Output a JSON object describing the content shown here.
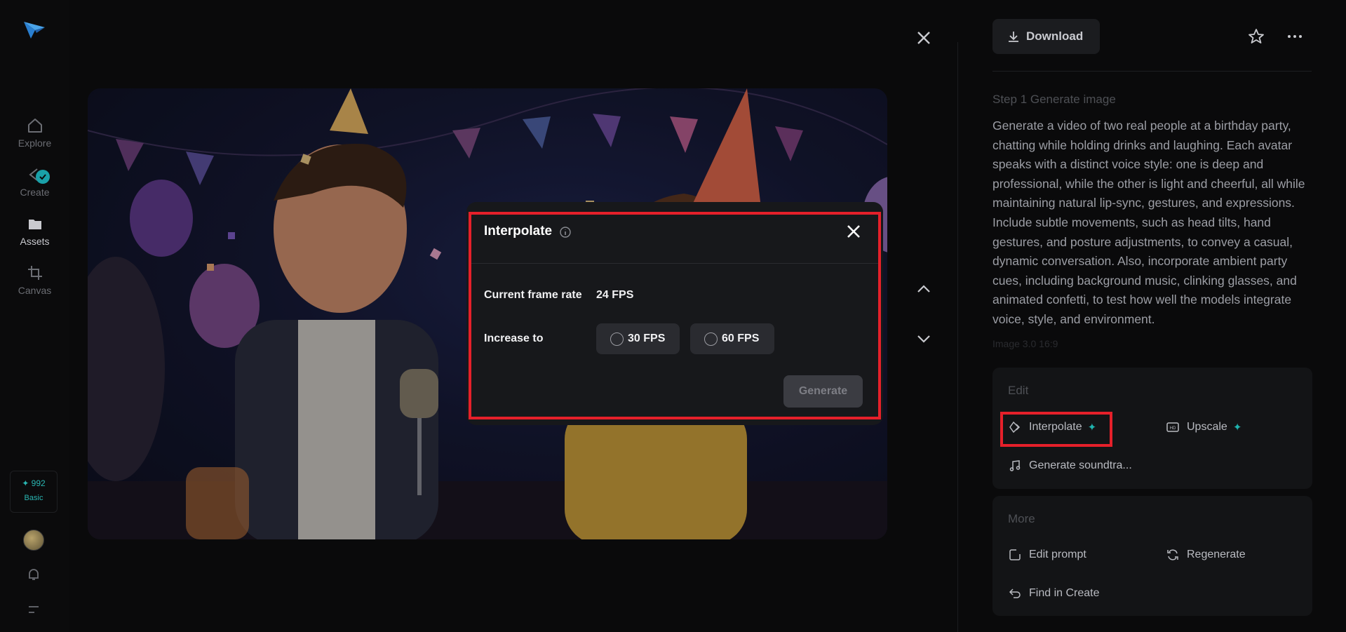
{
  "sidebar": {
    "items": [
      {
        "label": "Explore",
        "icon": "home-icon"
      },
      {
        "label": "Create",
        "icon": "create-icon"
      },
      {
        "label": "Assets",
        "icon": "folder-icon"
      },
      {
        "label": "Canvas",
        "icon": "crop-icon"
      }
    ],
    "credits": {
      "amount": "✦ 992",
      "plan": "Basic"
    }
  },
  "modal": {
    "title": "Interpolate",
    "current_label": "Current frame rate",
    "current_value": "24 FPS",
    "increase_label": "Increase to",
    "options": [
      "30 FPS",
      "60 FPS"
    ],
    "generate_label": "Generate"
  },
  "panel": {
    "download_label": "Download",
    "step_label": "Step 1 Generate image",
    "prompt": "Generate a video of two real people at a birthday party, chatting while holding drinks and laughing. Each avatar speaks with a distinct voice style: one is deep and professional, while the other is light and cheerful, all while maintaining natural lip-sync, gestures, and expressions. Include subtle movements, such as head tilts, hand gestures, and posture adjustments, to convey a casual, dynamic conversation. Also, incorporate ambient party cues, including background music, clinking glasses, and animated confetti, to test how well the models integrate voice, style, and environment.",
    "meta": "Image 3.0     16:9",
    "edit": {
      "title": "Edit",
      "interpolate": "Interpolate",
      "upscale": "Upscale",
      "soundtrack": "Generate soundtra..."
    },
    "more": {
      "title": "More",
      "edit_prompt": "Edit prompt",
      "regenerate": "Regenerate",
      "find_in_create": "Find in Create"
    }
  },
  "colors": {
    "accent": "#1fb3ae",
    "highlight": "#e5202a",
    "background": "#0a0a0b"
  }
}
